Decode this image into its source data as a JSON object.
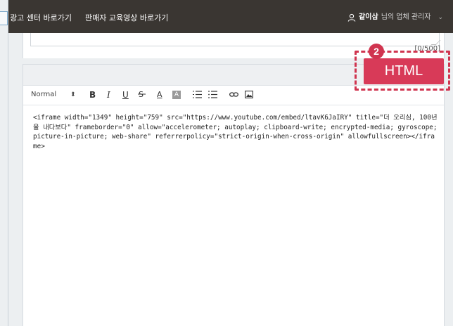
{
  "topbar": {
    "links": [
      "광고 센터 바로가기",
      "판매자 교육영상 바로가기"
    ],
    "user_name": "같이삼",
    "user_suffix": "님의 업체 관리자",
    "dropdown_icon": "chevron-down-icon"
  },
  "description_field": {
    "counter": "[0/500]"
  },
  "editor": {
    "toolbar": {
      "format_select": "Normal",
      "buttons": [
        "bold",
        "italic",
        "underline",
        "strike",
        "text-color",
        "background-color",
        "ordered-list",
        "bullet-list",
        "link",
        "image"
      ],
      "bold": "B",
      "italic": "I",
      "underline": "U",
      "strike": "S",
      "color": "A",
      "background": "A"
    },
    "content": "<iframe width=\"1349\" height=\"759\" src=\"https://www.youtube.com/embed/ltavK6JaIRY\" title=\"더 오리심, 100년을 내다보다\" frameborder=\"0\" allow=\"accelerometer; autoplay; clipboard-write; encrypted-media; gyroscope; picture-in-picture; web-share\" referrerpolicy=\"strict-origin-when-cross-origin\" allowfullscreen></iframe>"
  },
  "annotation": {
    "step": "2",
    "label": "HTML",
    "accent": "#d83a58"
  }
}
